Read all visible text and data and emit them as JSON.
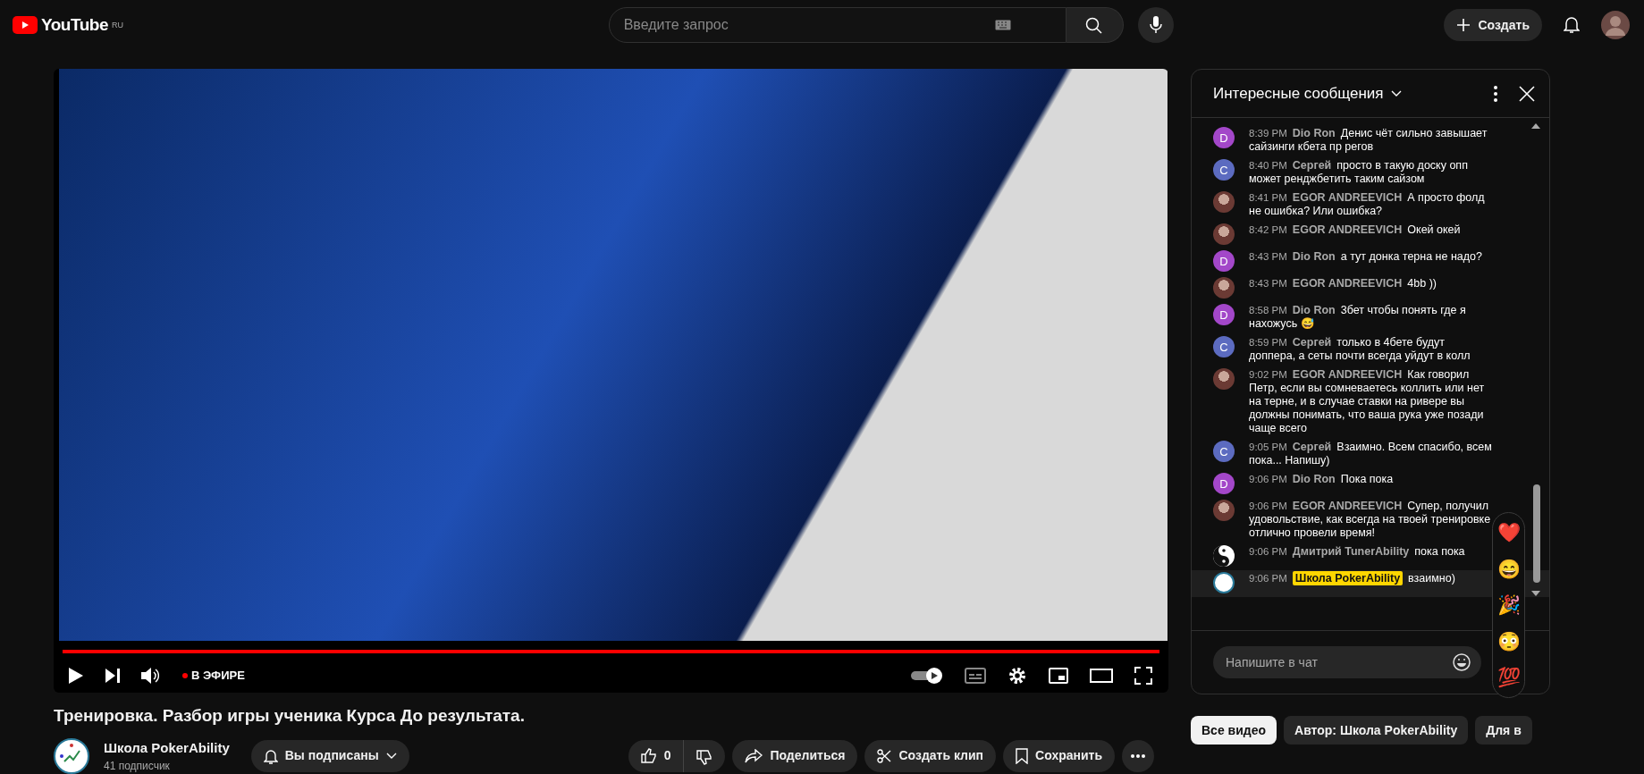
{
  "masthead": {
    "logo": "YouTube",
    "region": "RU",
    "search": {
      "placeholder": "Введите запрос"
    },
    "create_label": "Создать"
  },
  "player": {
    "progress": {
      "level": 1
    },
    "live_label": "В ЭФИРЕ"
  },
  "video": {
    "title": "Тренировка. Разбор игры ученика Курса До результата.",
    "channel": {
      "name": "Школа PokerAbility",
      "subscribers": "41 подписчик"
    },
    "subscribe_label": "Вы подписаны",
    "likes": "0",
    "actions": [
      "Поделиться",
      "Создать клип",
      "Сохранить"
    ]
  },
  "chat": {
    "title": "Интересные сообщения",
    "input": {
      "placeholder": "Напишите в чат"
    },
    "messages": [
      {
        "kind": "letter",
        "initial": "D",
        "color": "#a347c9",
        "time": "8:39 PM",
        "author": "Dio Ron",
        "text": "Денис чёт сильно завышает сайзинги кбета пр регов",
        "owner": false
      },
      {
        "kind": "letter",
        "initial": "C",
        "color": "#5c6bc0",
        "time": "8:40 PM",
        "author": "Сергей",
        "text": "просто в такую доску опп может ренджбетить таким сайзом",
        "owner": false
      },
      {
        "kind": "photo",
        "time": "8:41 PM",
        "author": "EGOR ANDREEVICH",
        "text": "А просто фолд не ошибка? Или ошибка?",
        "owner": false
      },
      {
        "kind": "photo",
        "time": "8:42 PM",
        "author": "EGOR ANDREEVICH",
        "text": "Окей окей",
        "owner": false
      },
      {
        "kind": "letter",
        "initial": "D",
        "color": "#a347c9",
        "time": "8:43 PM",
        "author": "Dio Ron",
        "text": "а тут донка терна не надо?",
        "owner": false
      },
      {
        "kind": "photo",
        "time": "8:43 PM",
        "author": "EGOR ANDREEVICH",
        "text": "4bb ))",
        "owner": false
      },
      {
        "kind": "letter",
        "initial": "D",
        "color": "#a347c9",
        "time": "8:58 PM",
        "author": "Dio Ron",
        "text": "3бет чтобы понять где я нахожусь 😅",
        "owner": false
      },
      {
        "kind": "letter",
        "initial": "C",
        "color": "#5c6bc0",
        "time": "8:59 PM",
        "author": "Сергей",
        "text": "только в 4бете будут доппера, а сеты почти всегда уйдут в колл",
        "owner": false
      },
      {
        "kind": "photo",
        "time": "9:02 PM",
        "author": "EGOR ANDREEVICH",
        "text": "Как говорил Петр, если вы сомневаетесь коллить или нет на терне, и в случае ставки на ривере вы должны понимать, что ваша рука уже позади чаще всего",
        "owner": false
      },
      {
        "kind": "letter",
        "initial": "C",
        "color": "#5c6bc0",
        "time": "9:05 PM",
        "author": "Сергей",
        "text": "Взаимно. Всем спасибо, всем пока... Напишу)",
        "owner": false
      },
      {
        "kind": "letter",
        "initial": "D",
        "color": "#a347c9",
        "time": "9:06 PM",
        "author": "Dio Ron",
        "text": "Пока пока",
        "owner": false
      },
      {
        "kind": "photo",
        "time": "9:06 PM",
        "author": "EGOR ANDREEVICH",
        "text": "Супер, получил удовольствие, как всегда на твоей тренировке отлично провели время!",
        "owner": false
      },
      {
        "kind": "yinyang",
        "time": "9:06 PM",
        "author": "Дмитрий TunerAbility",
        "text": "пока пока",
        "owner": false
      },
      {
        "kind": "logo",
        "time": "9:06 PM",
        "author": "Школа PokerAbility",
        "text": "взаимно)",
        "owner": true
      }
    ],
    "reactions": [
      "❤️",
      "😄",
      "🎉",
      "😳",
      "💯"
    ]
  },
  "chips": [
    {
      "label": "Все видео",
      "selected": true
    },
    {
      "label": "Автор: Школа PokerAbility",
      "selected": false
    },
    {
      "label": "Для в",
      "selected": false
    }
  ]
}
